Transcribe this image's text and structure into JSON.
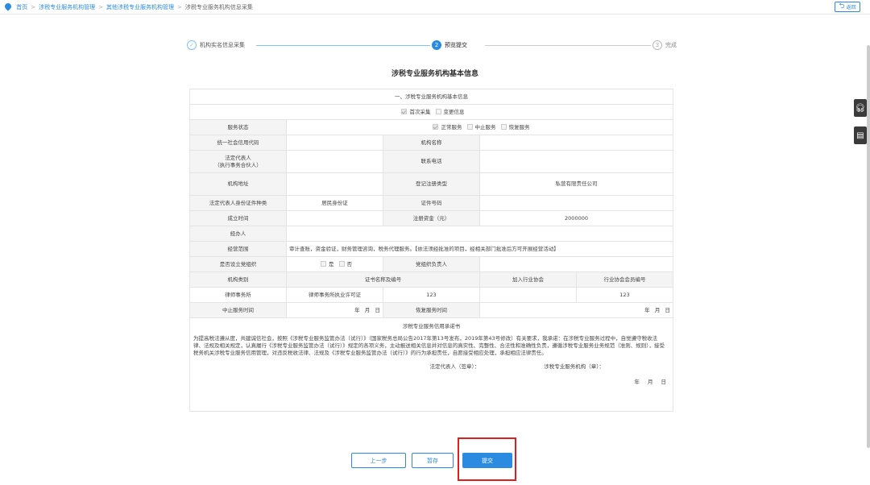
{
  "breadcrumb": {
    "home": "首页",
    "level1": "涉税专业服务机构管理",
    "level2": "其他涉税专业服务机构管理",
    "current": "涉税专业服务机构信息采集"
  },
  "back_label": "返回",
  "steps": [
    {
      "num": "✓",
      "label": "机构实名信息采集",
      "state": "done"
    },
    {
      "num": "2",
      "label": "预览提交",
      "state": "active"
    },
    {
      "num": "3",
      "label": "完成",
      "state": "todo"
    }
  ],
  "form_title": "涉税专业服务机构基本信息",
  "section_title": "一、涉税专业服务机构基本信息",
  "collect_options": [
    "首次采集",
    "变更信息"
  ],
  "service_status": {
    "label": "服务状态",
    "options": [
      "正常服务",
      "中止服务",
      "恢复服务"
    ]
  },
  "fields": {
    "credit_code": {
      "label": "统一社会信用代码",
      "value": ""
    },
    "org_name": {
      "label": "机构名称",
      "value": ""
    },
    "legal_rep": {
      "label": "法定代表人\n（执行事务合伙人）",
      "value": ""
    },
    "phone": {
      "label": "联系电话",
      "value": ""
    },
    "address": {
      "label": "机构地址",
      "value": ""
    },
    "reg_type": {
      "label": "登记注册类型",
      "value": "私营有限责任公司"
    },
    "id_type": {
      "label": "法定代表人身份证件种类",
      "value": "居民身份证"
    },
    "id_no": {
      "label": "证件号码",
      "value": ""
    },
    "founded": {
      "label": "成立时间",
      "value": ""
    },
    "capital": {
      "label": "注册资金（元）",
      "value": "2000000"
    },
    "handler": {
      "label": "经办人",
      "value": ""
    },
    "scope": {
      "label": "经营范围",
      "value": "审计查账，资金验证，财务管理咨询，税务代理服务。【依法须经批准的项目，经相关部门批准后方可开展经营活动】"
    },
    "party_org": {
      "label": "是否设立党组织",
      "yes": "是",
      "no": "否"
    },
    "party_head": {
      "label": "党组织负责人",
      "value": ""
    },
    "org_category": {
      "label": "机构类别",
      "value": "律师事务所"
    },
    "cert_header": "证书名称及编号",
    "cert_name": "律师事务所执业许可证",
    "cert_no": "123",
    "assoc_header": "加入行业协会",
    "assoc_no_header": "行业协会会员编号",
    "assoc_no": "123",
    "suspend_time": {
      "label": "中止服务时间",
      "value": "年   月   日"
    },
    "resume_time": {
      "label": "恢复服务时间",
      "value": "年   月   日"
    }
  },
  "promise": {
    "title": "涉税专业服务信用承诺书",
    "text": "为提高税法遵从度，共建诚信社会，按照《涉税专业服务监管办法（试行）》（国家税务总局公告2017年第13号发布，2019年第43号修改）有关要求，我承诺：在涉税专业服务过程中，自觉遵守税收法律、法规及相关规定，认真履行《涉税专业服务监管办法（试行）》规定的各项义务，主动报送相关信息并对信息的真实性、完整性、合法性和准确性负责，遵循涉税专业服务业务规范（准则、规则），接受税务机关涉税专业服务信用管理，对违反税收法律、法规及《涉税专业服务监管办法（试行）》的行为承担责任，自愿接受相应处理，承担相应法律责任。",
    "sign_legal": "法定代表人（签章）：",
    "sign_org": "涉税专业服务机构（章）：",
    "date": "年 月 日"
  },
  "buttons": {
    "prev": "上一步",
    "draft": "暂存",
    "submit": "提交"
  },
  "colors": {
    "accent": "#2a8be0",
    "highlight": "#e02020"
  }
}
